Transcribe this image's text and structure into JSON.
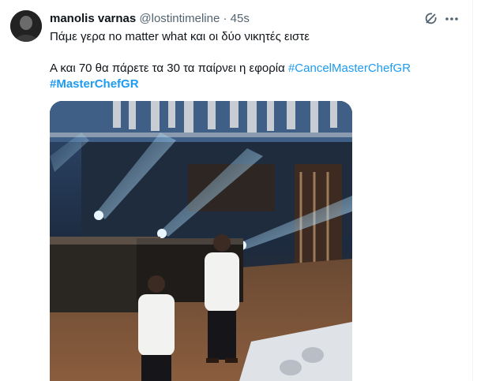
{
  "tweet": {
    "author_name": "manolis varnas",
    "handle": "@lostintimeline",
    "separator": "·",
    "time": "45s",
    "text_line1": "Πάμε γερα no matter what και οι δύο νικητές ειστε",
    "text_line2_prefix": "Α και 70 θα πάρετε τα  30 τα παίρνει η εφορία  ",
    "hashtag1": "#CancelMasterChefGR",
    "hashtag2": "#MasterChefGR",
    "colors": {
      "hashtag": "#1d9bf0",
      "muted": "#536471",
      "text": "#0f1419"
    },
    "icons": [
      "grok-icon",
      "more-icon"
    ]
  }
}
